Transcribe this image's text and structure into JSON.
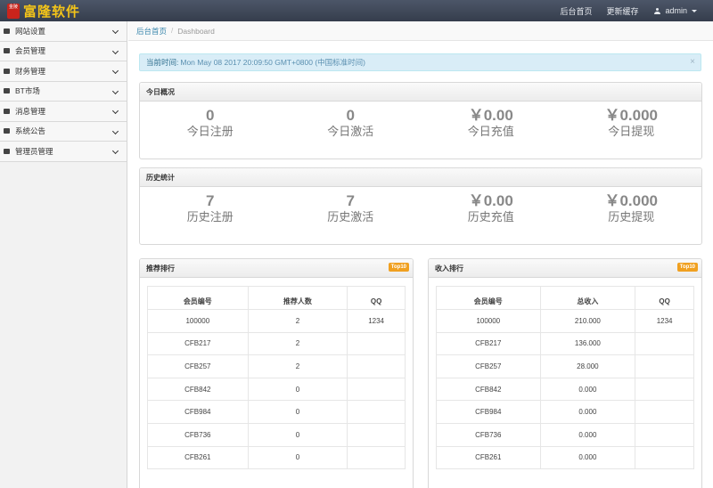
{
  "topbar": {
    "logo_badge": "金陵",
    "logo_text": "富隆软件",
    "links": [
      "后台首页",
      "更新缓存"
    ],
    "user": "admin"
  },
  "sidebar": {
    "items": [
      {
        "label": "网站设置",
        "icon": "home-icon"
      },
      {
        "label": "会员管理",
        "icon": "users-icon"
      },
      {
        "label": "财务管理",
        "icon": "wallet-icon"
      },
      {
        "label": "BT市场",
        "icon": "mail-icon"
      },
      {
        "label": "消息管理",
        "icon": "envelope-icon"
      },
      {
        "label": "系统公告",
        "icon": "link-icon"
      },
      {
        "label": "管理员管理",
        "icon": "user-icon"
      }
    ]
  },
  "breadcrumb": {
    "home": "后台首页",
    "separator": "/",
    "current": "Dashboard"
  },
  "alert": {
    "label": "当前时间:",
    "value": "Mon May 08 2017 20:09:50 GMT+0800 (中国标准时间)",
    "close": "×"
  },
  "today": {
    "title": "今日概况",
    "stats": [
      {
        "value": "0",
        "label": "今日注册"
      },
      {
        "value": "0",
        "label": "今日激活"
      },
      {
        "value": "￥0.00",
        "label": "今日充值"
      },
      {
        "value": "￥0.000",
        "label": "今日提现"
      }
    ]
  },
  "history": {
    "title": "历史统计",
    "stats": [
      {
        "value": "7",
        "label": "历史注册"
      },
      {
        "value": "7",
        "label": "历史激活"
      },
      {
        "value": "￥0.00",
        "label": "历史充值"
      },
      {
        "value": "￥0.000",
        "label": "历史提现"
      }
    ]
  },
  "referral": {
    "title": "推荐排行",
    "badge": "Top10",
    "headers": [
      "会员编号",
      "推荐人数",
      "QQ"
    ],
    "rows": [
      [
        "100000",
        "2",
        "1234"
      ],
      [
        "CFB217",
        "2",
        ""
      ],
      [
        "CFB257",
        "2",
        ""
      ],
      [
        "CFB842",
        "0",
        ""
      ],
      [
        "CFB984",
        "0",
        ""
      ],
      [
        "CFB736",
        "0",
        ""
      ],
      [
        "CFB261",
        "0",
        ""
      ]
    ]
  },
  "income": {
    "title": "收入排行",
    "badge": "Top10",
    "headers": [
      "会员编号",
      "总收入",
      "QQ"
    ],
    "rows": [
      [
        "100000",
        "210.000",
        "1234"
      ],
      [
        "CFB217",
        "136.000",
        ""
      ],
      [
        "CFB257",
        "28.000",
        ""
      ],
      [
        "CFB842",
        "0.000",
        ""
      ],
      [
        "CFB984",
        "0.000",
        ""
      ],
      [
        "CFB736",
        "0.000",
        ""
      ],
      [
        "CFB261",
        "0.000",
        ""
      ]
    ]
  }
}
